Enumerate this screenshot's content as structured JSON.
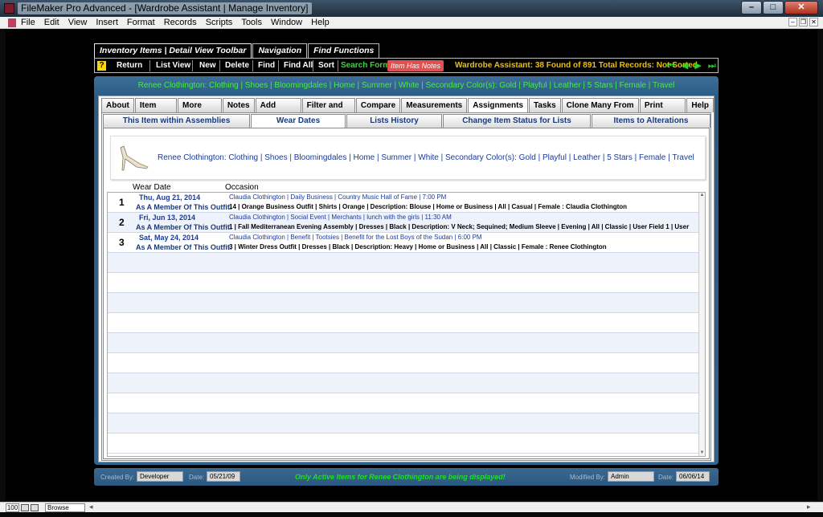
{
  "window": {
    "title": "FileMaker Pro Advanced - [Wardrobe Assistant | Manage Inventory]",
    "minimize": "–",
    "maximize": "□",
    "close": "✕"
  },
  "menu": [
    "File",
    "Edit",
    "View",
    "Insert",
    "Format",
    "Records",
    "Scripts",
    "Tools",
    "Window",
    "Help"
  ],
  "mdi_controls": [
    "–",
    "❐",
    "✕"
  ],
  "toolbar_tabs": [
    "Inventory Items | Detail View Toolbar",
    "Navigation",
    "Find Functions"
  ],
  "toolbar": {
    "help": "?",
    "buttons": [
      "Return",
      "List View",
      "New",
      "Delete",
      "Find",
      "Find All",
      "Sort"
    ],
    "search_form": "Search Form",
    "item_has_notes": "Item Has Notes",
    "status": "Wardrobe Assistant:  38 Found of 891 Total Records: Not Sorted",
    "nav_icons": [
      "first-record-icon",
      "prev-record-icon",
      "next-record-icon",
      "last-record-icon"
    ]
  },
  "summary": "Renee Clothington: Clothing | Shoes | Bloomingdales | Home | Summer | White | Secondary Color(s): Gold | Playful | Leather | 5 Stars | Female | Travel",
  "main_tabs": [
    "About",
    "Item Detail",
    "More Detail",
    "Notes",
    "Add Images",
    "Filter and Flag",
    "Compare",
    "Measurements",
    "Assignments",
    "Tasks",
    "Clone Many From One",
    "Print Center",
    "Help"
  ],
  "main_tab_active": "Assignments",
  "sub_tabs": [
    "This Item within Assemblies",
    "Wear Dates",
    "Lists History",
    "Change Item Status for Lists",
    "Items to Alterations"
  ],
  "sub_tab_active": "Wear Dates",
  "item_desc": "Renee Clothington: Clothing | Shoes | Bloomingdales | Home | Summer | White | Secondary Color(s): Gold | Playful | Leather | 5 Stars | Female | Travel",
  "columns": {
    "wear_date": "Wear Date",
    "occasion": "Occasion"
  },
  "member_label": "As A Member Of This Outfit:",
  "rows": [
    {
      "num": "1",
      "date": "Thu, Aug 21, 2014",
      "occasion": "Claudia Clothington | Daily Business | Country Music Hall of Fame | 7:00 PM",
      "member": "14 | Orange Business Outfit | Shirts | Orange | Description: Blouse | Home or Business | All | Casual | Female : Claudia Clothington"
    },
    {
      "num": "2",
      "date": "Fri, Jun 13, 2014",
      "occasion": "Claudia Clothington | Social Event | Merchants | lunch with the girls | 11:30 AM",
      "member": "1 | Fall Mediterranean Evening Assembly | Dresses | Black | Description: V Neck; Sequined; Medium Sleeve | Evening | All | Classic | User Field 1 | User"
    },
    {
      "num": "3",
      "date": "Sat, May 24, 2014",
      "occasion": "Claudia Clothington | Benefit | Tootsies | Benefit for the Lost Boys of the Sudan | 6:00 PM",
      "member": "3 | Winter Dress Outfit | Dresses | Black | Description: Heavy | Home or Business | All | Classic | Female : Renee Clothington"
    }
  ],
  "footer": {
    "created_by_label": "Created By:",
    "created_by": "Developer",
    "date_label": "Date:",
    "created_date": "05/21/09",
    "message": "Only Active Items for Renee Clothington are being displayed!",
    "modified_by_label": "Modified By:",
    "modified_by": "Admin",
    "modified_date": "06/06/14"
  },
  "statusbar": {
    "zoom": "100",
    "mode": "Browse"
  },
  "colors": {
    "accent_green": "#22dd22",
    "status_yellow": "#f0c000",
    "panel_blue": "#2f6390",
    "link_blue": "#1a3a9a"
  }
}
